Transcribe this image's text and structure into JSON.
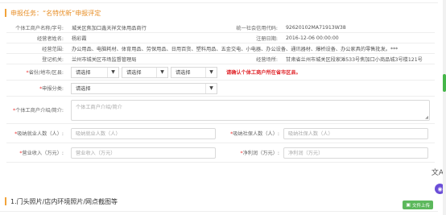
{
  "task": {
    "title": "申报任务：“名特优新”申报评定",
    "section2_title": "1.门头照片/店内环境照片/网点截图等",
    "upload_label": "文件上传"
  },
  "info": {
    "name_label": "个体工商户名称/字号:",
    "name_value": "城关区焦加口鑫天祥文体用品商行",
    "credit_label": "统一社会信用代码:",
    "credit_value": "92620102MA71913W38",
    "operator_label": "经营者姓名:",
    "operator_value": "杨彩霞",
    "regdate_label": "注册日期:",
    "regdate_value": "2016-12-06 00:00:00",
    "scope_label": "经营范围:",
    "scope_value": "办公用品、电脑耗材、体育用品、劳保用品、日用百货、塑料用品、五金交电、小电器、办公设备、通讯器材、爆桥设备、办公家具的零售批发。***",
    "authority_label": "登记机关:",
    "authority_value": "兰州市城关区市场监督管理局",
    "place_label": "经营场所:",
    "place_value": "甘肃省兰州市城关区段家滩533号焦加口小商品城3号楼121号"
  },
  "form": {
    "region_label": "省份/地市/区县:",
    "region_selects": [
      "请选择",
      "请选择",
      "请选择"
    ],
    "region_warning": "请确认个体工商户所在省市区县。",
    "category_label": "申报分类:",
    "category_select": "请选择",
    "intro_label": "个体工商户介绍/简介:",
    "intro_placeholder": "个体工商户介绍/简介",
    "employ_label": "吸纳就业人数（人）:",
    "employ_placeholder": "吸纳就业人数（人）",
    "social_label": "吸纳社保人数（人）:",
    "social_placeholder": "吸纳社保人数（人）",
    "revenue_label": "营业收入（万元）:",
    "revenue_placeholder": "营业收入（万元）",
    "profit_label": "净利润（万元）:",
    "profit_placeholder": "净利润（万元）",
    "required_mark": "*"
  },
  "colors": {
    "accent": "#f2a33a",
    "warning": "#e0262b",
    "upload": "#5cb85c",
    "scroll_thumb": "#45b649"
  },
  "icons": {
    "select_arrow": "▼",
    "translate": "文A",
    "ai": "ai-assistant-icon",
    "upload": "upload-icon"
  }
}
